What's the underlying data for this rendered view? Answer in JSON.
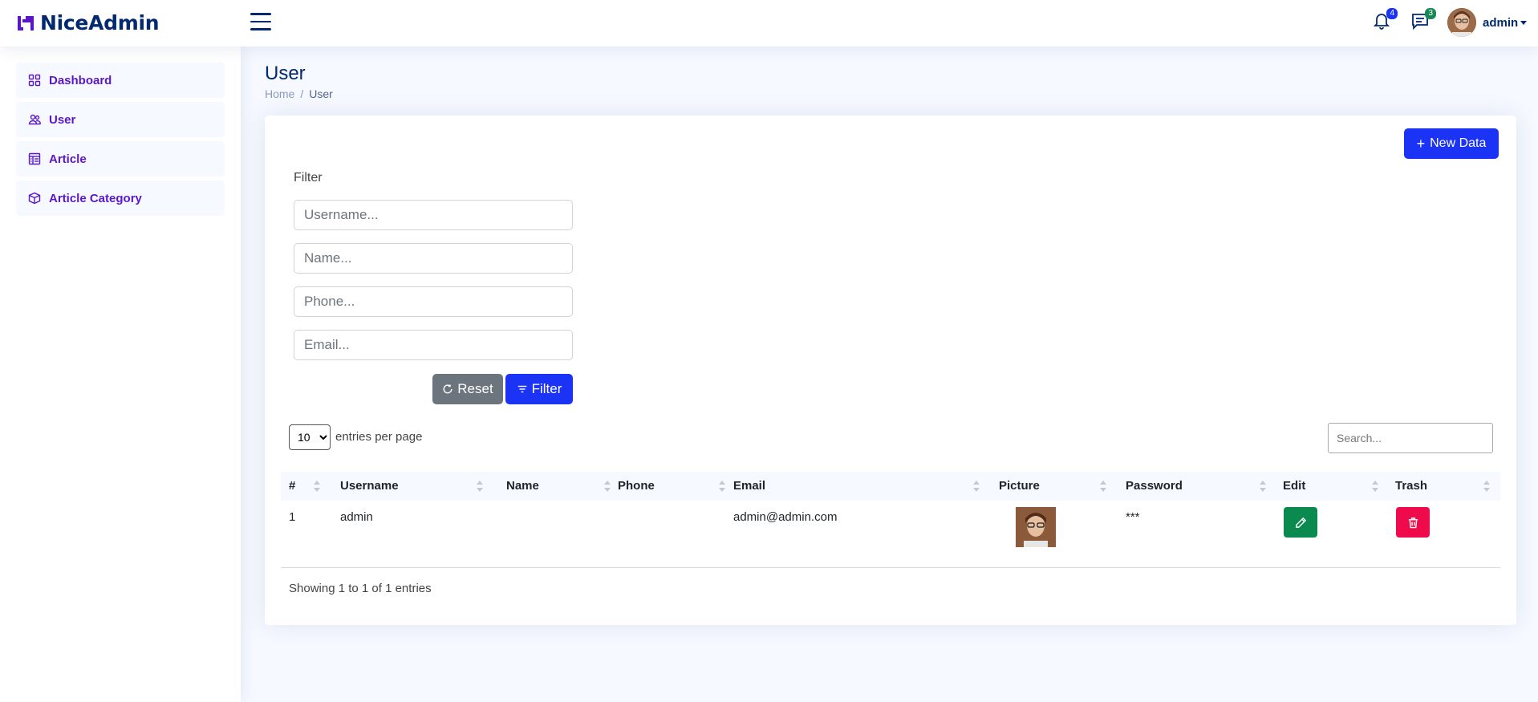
{
  "app": {
    "brand": "NiceAdmin"
  },
  "header": {
    "notifications_count": "4",
    "messages_count": "3",
    "profile_name": "admin",
    "colors": {
      "notif_badge": "#1a33f5",
      "msg_badge": "#198754"
    }
  },
  "sidebar": {
    "items": [
      {
        "label": "Dashboard",
        "icon": "grid-icon"
      },
      {
        "label": "User",
        "icon": "people-icon"
      },
      {
        "label": "Article",
        "icon": "layout-text-icon"
      },
      {
        "label": "Article Category",
        "icon": "box-icon"
      }
    ]
  },
  "page": {
    "title": "User",
    "breadcrumb": [
      "Home",
      "User"
    ]
  },
  "card": {
    "new_button": "New Data",
    "filter_label": "Filter",
    "fields": {
      "username_placeholder": "Username...",
      "name_placeholder": "Name...",
      "phone_placeholder": "Phone...",
      "email_placeholder": "Email..."
    },
    "reset_button": "Reset",
    "filter_button": "Filter"
  },
  "table": {
    "per_page_value": "10",
    "per_page_label": "entries per page",
    "search_placeholder": "Search...",
    "columns": [
      "#",
      "Username",
      "Name",
      "Phone",
      "Email",
      "Picture",
      "Password",
      "Edit",
      "Trash"
    ],
    "rows": [
      {
        "num": "1",
        "username": "admin",
        "name": "",
        "phone": "",
        "email": "admin@admin.com",
        "password": "***"
      }
    ],
    "footer": "Showing 1 to 1 of 1 entries"
  }
}
